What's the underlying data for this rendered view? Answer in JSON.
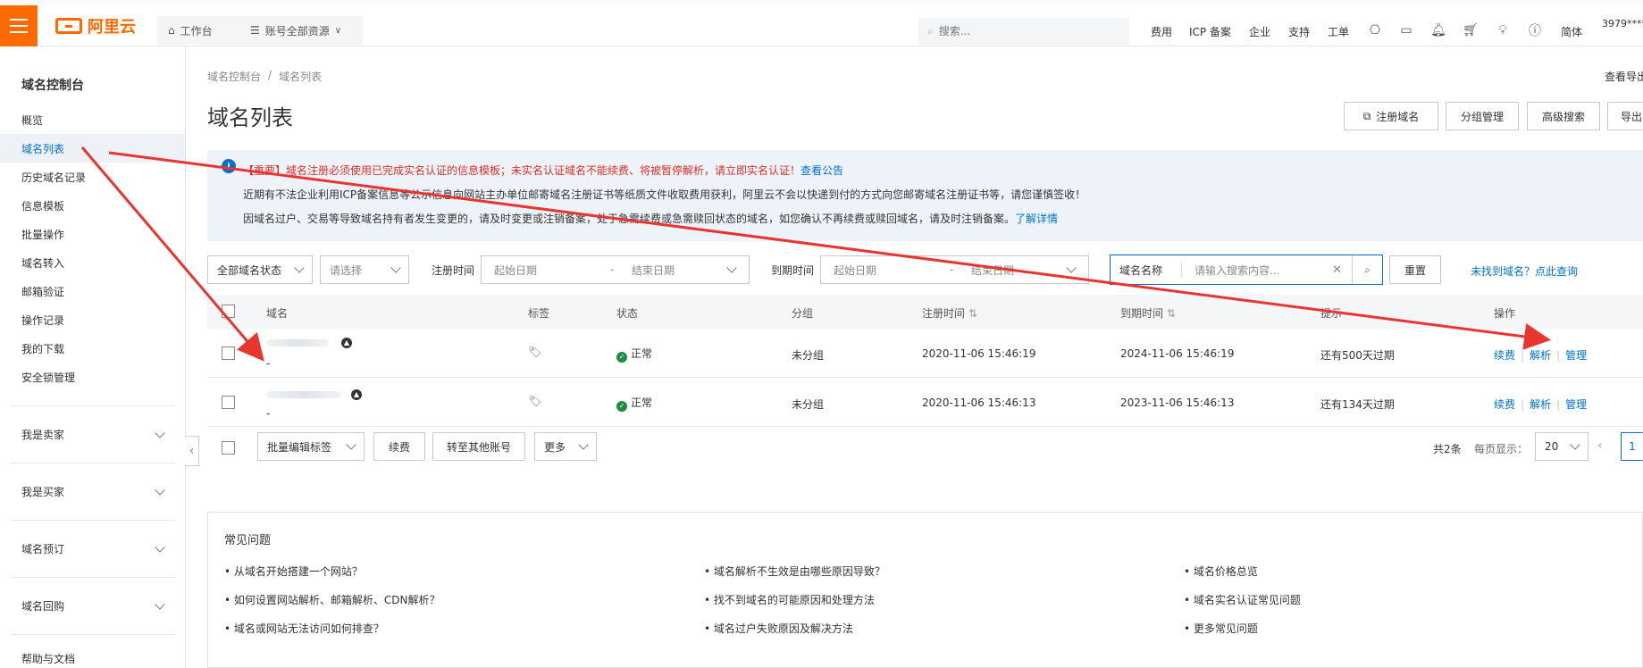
{
  "topbar": {
    "logo_text": "阿里云",
    "workbench": "工作台",
    "resources": "账号全部资源",
    "search_placeholder": "搜索...",
    "links": [
      "费用",
      "ICP 备案",
      "企业",
      "支持",
      "工单"
    ],
    "lang": "简体",
    "account": "3979****"
  },
  "sidebar": {
    "title": "域名控制台",
    "items": [
      "概览",
      "域名列表",
      "历史域名记录",
      "信息模板",
      "批量操作",
      "域名转入",
      "邮箱验证",
      "操作记录",
      "我的下载",
      "安全锁管理"
    ],
    "groups": [
      "我是卖家",
      "我是买家",
      "域名预订",
      "域名回购"
    ],
    "footer": "帮助与文档"
  },
  "breadcrumb": {
    "root": "域名控制台",
    "sep": "/",
    "current": "域名列表"
  },
  "page_title": "域名列表",
  "export_record": "查看导出",
  "actions": {
    "register": "注册域名",
    "group_manage": "分组管理",
    "advanced_search": "高级搜索",
    "export": "导出"
  },
  "notice": {
    "line1_prefix": "【重要】域名注册必须使用已完成实名认证的信息模板；未实名认证域名不能续费、将被暂停解析，请立即实名认证！",
    "line1_link": "查看公告",
    "line2": "近期有不法企业利用ICP备案信息等公示信息向网站主办单位邮寄域名注册证书等纸质文件收取费用获利，阿里云不会以快递到付的方式向您邮寄域名注册证书等，请您谨慎签收！",
    "line3_prefix": "因域名过户、交易等导致域名持有者发生变更的，请及时变更或注销备案，处于急需续费或急需赎回状态的域名，如您确认不再续费或赎回域名，请及时注销备案。",
    "line3_link": "了解详情"
  },
  "filters": {
    "status": "全部域名状态",
    "select_ph": "请选择",
    "reg_time_label": "注册时间",
    "start_date": "起始日期",
    "dash": "-",
    "end_date": "结束日期",
    "exp_time_label": "到期时间",
    "search_field": "域名名称",
    "search_ph": "请输入搜索内容...",
    "reset": "重置",
    "not_found": "未找到域名？点此查询"
  },
  "table": {
    "headers": [
      "域名",
      "标签",
      "状态",
      "分组",
      "注册时间",
      "到期时间",
      "提示",
      "操作"
    ],
    "rows": [
      {
        "sub": "-",
        "status": "正常",
        "group": "未分组",
        "reg": "2020-11-06 15:46:19",
        "exp": "2024-11-06 15:46:19",
        "tip": "还有500天过期"
      },
      {
        "sub": "-",
        "status": "正常",
        "group": "未分组",
        "reg": "2020-11-06 15:46:13",
        "exp": "2023-11-06 15:46:13",
        "tip": "还有134天过期"
      }
    ],
    "ops": [
      "续费",
      "解析",
      "管理"
    ]
  },
  "bulk": {
    "edit_tags": "批量编辑标签",
    "renew": "续费",
    "transfer": "转至其他账号",
    "more": "更多"
  },
  "pagination": {
    "total": "共2条",
    "per_page_label": "每页显示：",
    "per_page": "20",
    "page": "1"
  },
  "faq": {
    "title": "常见问题",
    "col1": [
      "从域名开始搭建一个网站？",
      "如何设置网站解析、邮箱解析、CDN解析？",
      "域名或网站无法访问如何排查？"
    ],
    "col2": [
      "域名解析不生效是由哪些原因导致？",
      "找不到域名的可能原因和处理方法",
      "域名过户失败原因及解决方法"
    ],
    "col3": [
      "域名价格总览",
      "域名实名认证常见问题",
      "更多常见问题"
    ]
  },
  "colors": {
    "brand": "#ff6a00",
    "link": "#0070cc",
    "annotation": "#e8352f"
  }
}
